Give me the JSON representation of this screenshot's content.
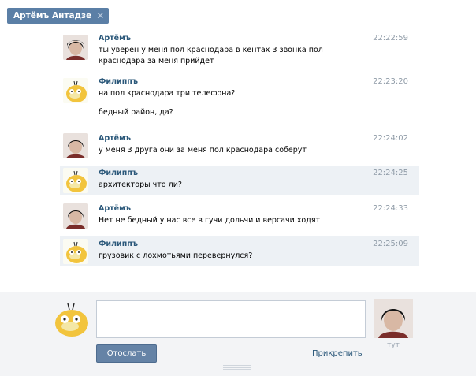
{
  "tab": {
    "title": "Артёмъ Антадзе",
    "close": "✕"
  },
  "messages": [
    {
      "author": "Артёмъ",
      "time": "22:22:59",
      "lines": [
        "ты уверен у меня пол краснодара в кентах 3 звонка пол",
        "краснодара за меня прийдет"
      ],
      "avatar": "person"
    },
    {
      "author": "Филиппъ",
      "time": "22:23:20",
      "lines": [
        "на пол краснодара три телефона?",
        "",
        "бедный район, да?"
      ],
      "avatar": "duck"
    },
    {
      "author": "Артёмъ",
      "time": "22:24:02",
      "lines": [
        "у меня 3 друга они за меня пол краснодара соберут"
      ],
      "avatar": "person"
    },
    {
      "author": "Филиппъ",
      "time": "22:24:25",
      "lines": [
        "архитекторы что ли?"
      ],
      "avatar": "duck",
      "highlight": true
    },
    {
      "author": "Артёмъ",
      "time": "22:24:33",
      "lines": [
        "Нет не бедный у нас все в гучи дольчи и версачи ходят"
      ],
      "avatar": "person"
    },
    {
      "author": "Филиппъ",
      "time": "22:25:09",
      "lines": [
        "грузовик с лохмотьями перевернулся?"
      ],
      "avatar": "duck",
      "highlight": true
    }
  ],
  "composer": {
    "send_label": "Отослать",
    "attach_label": "Прикрепить",
    "here_label": "тут"
  },
  "colors": {
    "accent": "#5b7fa6",
    "link": "#2b587a",
    "highlight": "#edf1f5"
  }
}
